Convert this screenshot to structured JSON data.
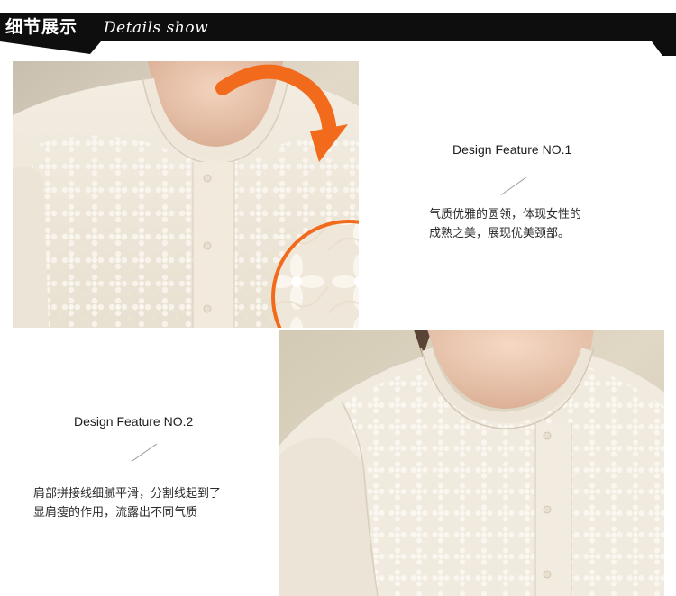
{
  "header": {
    "title_cn": "细节展示",
    "title_en": "Details show"
  },
  "colors": {
    "header_bg": "#0e0e0e",
    "accent_orange": "#f26a1b",
    "fabric": "#f1ebde"
  },
  "features": [
    {
      "title": "Design Feature NO.1",
      "desc_lines": [
        "气质优雅的圆领，体现女性的",
        "成熟之美，展现优美颈部。"
      ]
    },
    {
      "title": "Design Feature NO.2",
      "desc_lines": [
        "肩部拼接线细腻平滑，分割线起到了",
        "显肩瘦的作用，流露出不同气质"
      ]
    }
  ]
}
